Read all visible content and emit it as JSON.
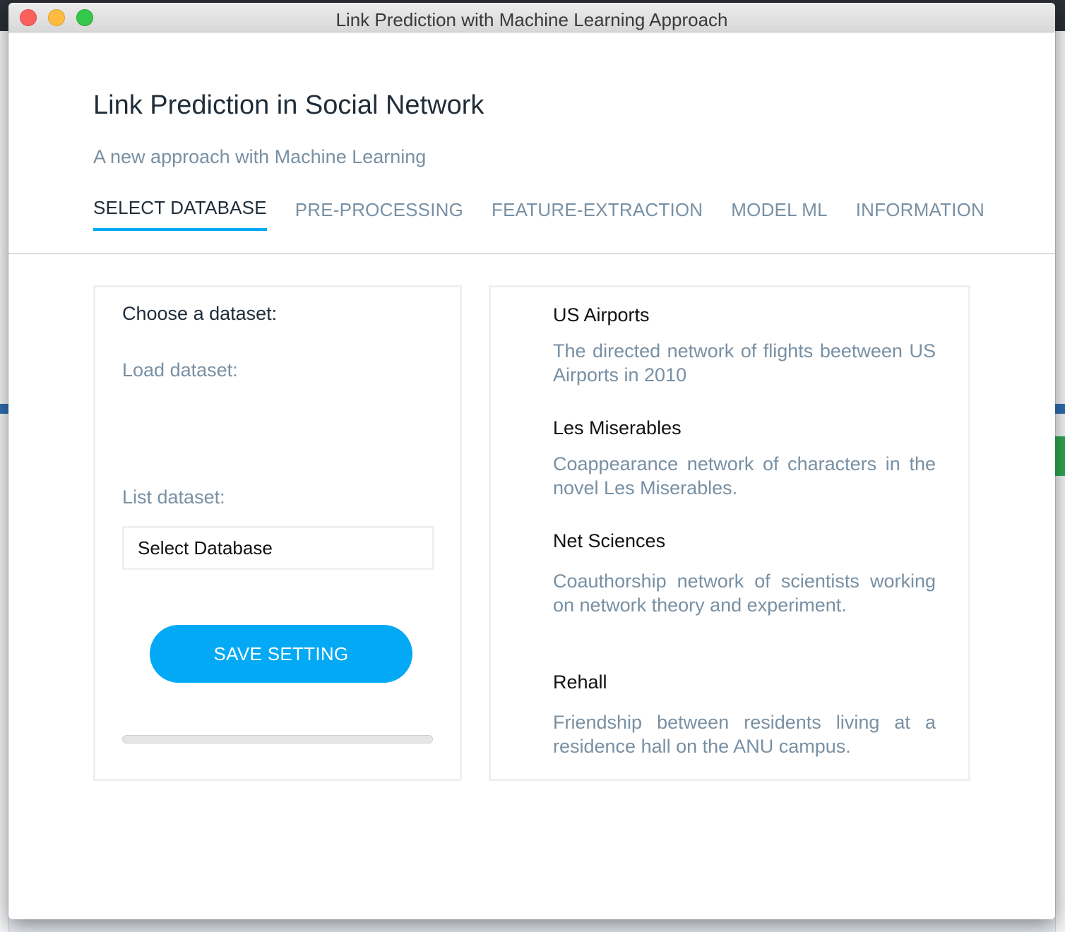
{
  "window": {
    "title": "Link Prediction with Machine Learning Approach"
  },
  "header": {
    "title": "Link Prediction in Social Network",
    "subtitle": "A new approach with Machine Learning"
  },
  "tabs": [
    {
      "label": "SELECT DATABASE",
      "active": true
    },
    {
      "label": "PRE-PROCESSING",
      "active": false
    },
    {
      "label": "FEATURE-EXTRACTION",
      "active": false
    },
    {
      "label": "MODEL ML",
      "active": false
    },
    {
      "label": "INFORMATION",
      "active": false
    }
  ],
  "left_panel": {
    "choose_label": "Choose a dataset:",
    "load_label": "Load dataset:",
    "list_label": "List dataset:",
    "select_value": "Select Database",
    "save_button": "SAVE SETTING",
    "progress": 0
  },
  "datasets": [
    {
      "name": "US Airports",
      "description": "The directed network of flights beetween US Airports in 2010"
    },
    {
      "name": "Les Miserables",
      "description": "Coappearance network of characters in the novel Les Miserables."
    },
    {
      "name": "Net Sciences",
      "description": "Coauthorship network of scientists working on network theory and experiment."
    },
    {
      "name": "Rehall",
      "description": "Friendship between residents living at a residence hall on the ANU campus."
    }
  ],
  "colors": {
    "accent": "#03a9f4",
    "muted_text": "#7890a4",
    "dark_text": "#1f2d3a"
  }
}
